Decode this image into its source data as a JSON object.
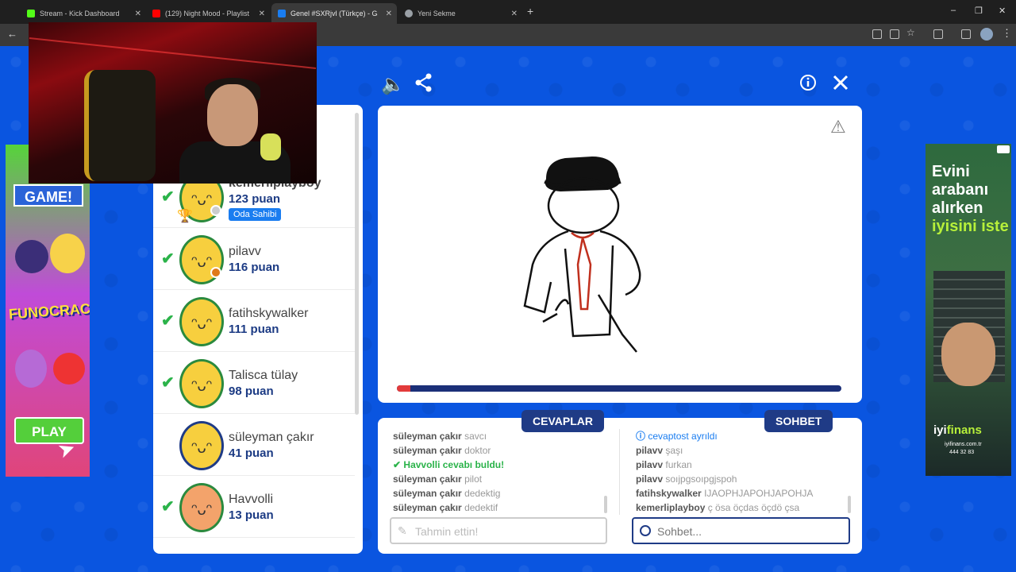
{
  "browser": {
    "tabs": [
      {
        "title": "Stream - Kick Dashboard",
        "color": "#53fc18"
      },
      {
        "title": "(129) Night Mood - Playlist",
        "color": "#ff0000"
      },
      {
        "title": "Genel #SXRjvl (Türkçe) - Gartic",
        "color": "#1a7df0"
      },
      {
        "title": "Yeni Sekme",
        "color": "#9aa0a6"
      }
    ],
    "new_tab": "+",
    "window": {
      "minimize": "–",
      "restore": "❐",
      "close": "✕"
    },
    "back": "←",
    "menu": "⋮"
  },
  "game": {
    "icons": {
      "sound": "speaker-icon",
      "share": "share-icon",
      "info": "info-icon",
      "close": "close-icon"
    },
    "players": [
      {
        "name": "kemerliplayboy",
        "points": "123 puan",
        "guessed": true,
        "badge": "Oda Sahibi",
        "trophy": true,
        "status": "gray"
      },
      {
        "name": "pilavv",
        "points": "116 puan",
        "guessed": true,
        "status": "orange"
      },
      {
        "name": "fatihskywalker",
        "points": "111 puan",
        "guessed": true
      },
      {
        "name": "Talisca tülay",
        "points": "98 puan",
        "guessed": true
      },
      {
        "name": "süleyman çakır",
        "points": "41 puan",
        "guessed": false
      },
      {
        "name": "Havvolli",
        "points": "13 puan",
        "guessed": true
      }
    ],
    "timer_fraction": 0.03,
    "colors": {
      "accent": "#1f3b86",
      "success": "#2bb34a",
      "timer": "#e23b3b",
      "background": "#0a55e0"
    },
    "answers_tab": "CEVAPLAR",
    "chat_tab": "SOHBET",
    "answers": [
      {
        "who": "süleyman çakır",
        "text": "savcı"
      },
      {
        "who": "süleyman çakır",
        "text": "doktor"
      },
      {
        "who": "✔",
        "text": "Havvolli cevabı buldu!",
        "kind": "success"
      },
      {
        "who": "süleyman çakır",
        "text": "pilot"
      },
      {
        "who": "süleyman çakır",
        "text": "dedektig"
      },
      {
        "who": "süleyman çakır",
        "text": "dedektif"
      }
    ],
    "chat": [
      {
        "who": "ⓘ",
        "text": "cevaptost ayrıldı",
        "kind": "info"
      },
      {
        "who": "pilavv",
        "text": "şaşı"
      },
      {
        "who": "pilavv",
        "text": "furkan"
      },
      {
        "who": "pilavv",
        "text": "soıjpgsoıpgjspoh"
      },
      {
        "who": "fatihskywalker",
        "text": "IJAOPHJAPOHJAPOHJA"
      },
      {
        "who": "kemerliplayboy",
        "text": "ç ösa öçdas öçdö çsa"
      }
    ],
    "guess_placeholder": "Tahmin ettin!",
    "chat_placeholder": "Sohbet...",
    "chat_value": ""
  },
  "ad_right": {
    "headline_1": "Evini arabanı alırken",
    "headline_2": "iyisini iste",
    "brand_1": "iyi",
    "brand_2": "finans",
    "site": "iyifinans.com.tr",
    "phone": "444 32 83"
  },
  "ad_left": {
    "game_label": "GAME!",
    "fun_label": "FUNOCRACY",
    "play_label": "PLAY"
  }
}
